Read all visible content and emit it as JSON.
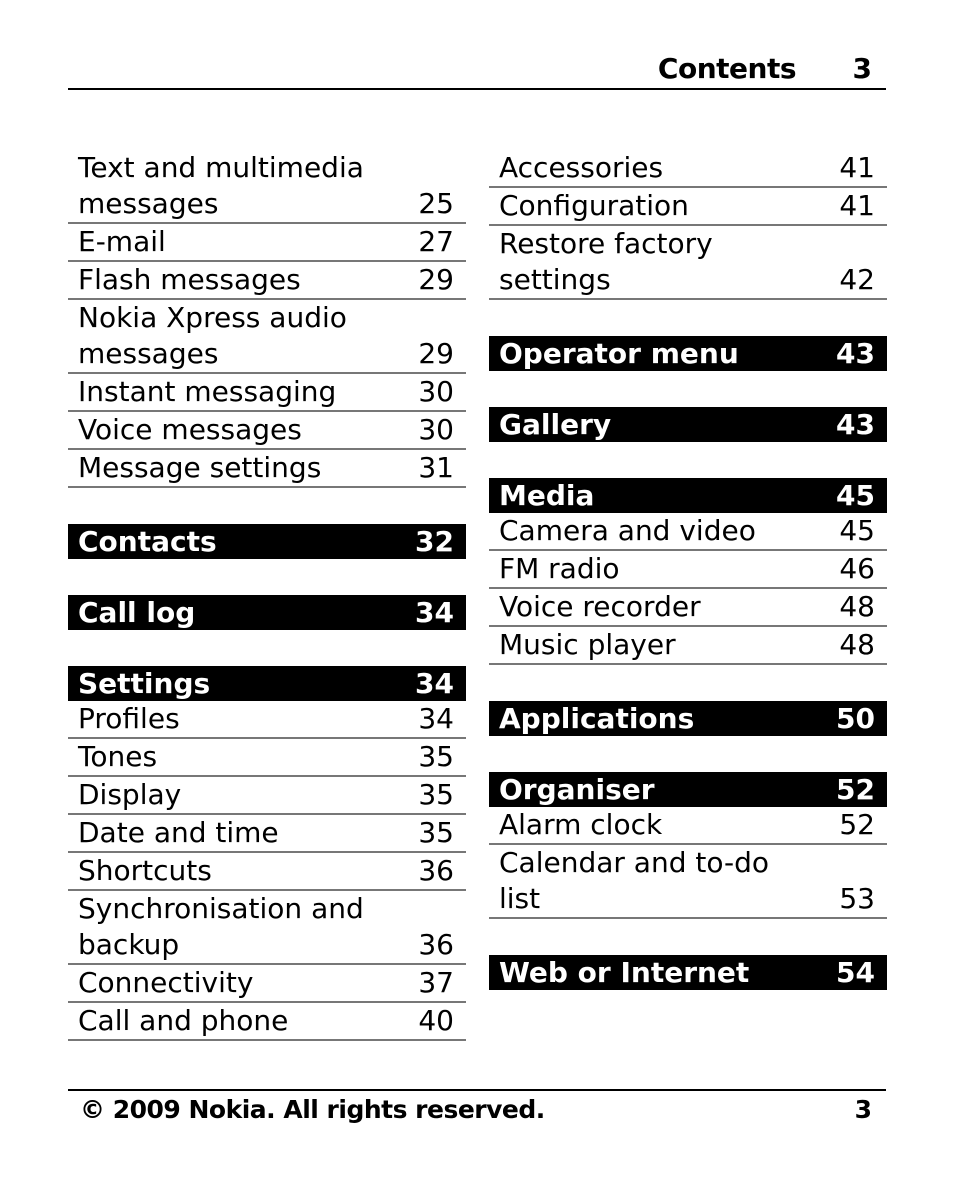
{
  "header": {
    "title": "Contents",
    "page_number": "3"
  },
  "left_column": [
    {
      "type": "entry",
      "label": "Text and multimedia messages",
      "page": "25"
    },
    {
      "type": "entry",
      "label": "E-mail",
      "page": "27"
    },
    {
      "type": "entry",
      "label": "Flash messages",
      "page": "29"
    },
    {
      "type": "entry",
      "label": "Nokia Xpress audio messages",
      "page": "29"
    },
    {
      "type": "entry",
      "label": "Instant messaging",
      "page": "30"
    },
    {
      "type": "entry",
      "label": "Voice messages",
      "page": "30"
    },
    {
      "type": "entry",
      "label": "Message settings",
      "page": "31"
    },
    {
      "type": "section",
      "label": "Contacts",
      "page": "32"
    },
    {
      "type": "section",
      "label": "Call log",
      "page": "34"
    },
    {
      "type": "section",
      "label": "Settings",
      "page": "34"
    },
    {
      "type": "entry",
      "label": "Profiles",
      "page": "34"
    },
    {
      "type": "entry",
      "label": "Tones",
      "page": "35"
    },
    {
      "type": "entry",
      "label": "Display",
      "page": "35"
    },
    {
      "type": "entry",
      "label": "Date and time",
      "page": "35"
    },
    {
      "type": "entry",
      "label": "Shortcuts",
      "page": "36"
    },
    {
      "type": "entry",
      "label": "Synchronisation and backup",
      "page": "36"
    },
    {
      "type": "entry",
      "label": "Connectivity",
      "page": "37"
    },
    {
      "type": "entry",
      "label": "Call and phone",
      "page": "40"
    }
  ],
  "right_column": [
    {
      "type": "entry",
      "label": "Accessories",
      "page": "41"
    },
    {
      "type": "entry",
      "label": "Configuration",
      "page": "41"
    },
    {
      "type": "entry",
      "label": "Restore factory settings",
      "page": "42"
    },
    {
      "type": "section",
      "label": "Operator menu",
      "page": "43"
    },
    {
      "type": "section",
      "label": "Gallery",
      "page": "43"
    },
    {
      "type": "section",
      "label": "Media",
      "page": "45"
    },
    {
      "type": "entry",
      "label": "Camera and video",
      "page": "45"
    },
    {
      "type": "entry",
      "label": "FM radio",
      "page": "46"
    },
    {
      "type": "entry",
      "label": "Voice recorder",
      "page": "48"
    },
    {
      "type": "entry",
      "label": "Music player",
      "page": "48"
    },
    {
      "type": "section",
      "label": "Applications",
      "page": "50"
    },
    {
      "type": "section",
      "label": "Organiser",
      "page": "52"
    },
    {
      "type": "entry",
      "label": "Alarm clock",
      "page": "52"
    },
    {
      "type": "entry",
      "label": "Calendar and to-do list",
      "page": "53"
    },
    {
      "type": "section",
      "label": "Web or Internet",
      "page": "54"
    }
  ],
  "footer": {
    "copyright": "© 2009 Nokia. All rights reserved.",
    "page_number": "3"
  }
}
